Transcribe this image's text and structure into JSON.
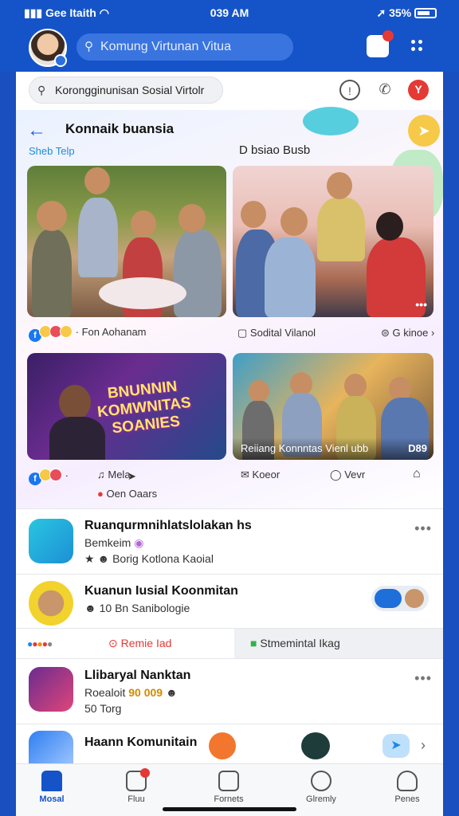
{
  "status_bar": {
    "carrier": "Gee Itaith",
    "time": "039 AM",
    "battery": "35%"
  },
  "app_bar": {
    "search_text": "Komung Virtunan Vitua"
  },
  "search_bar": {
    "text": "Korongginunisan Sosial Virtolr"
  },
  "hero": {
    "title": "Konnaik buansia",
    "sub_left": "Sheb Telp",
    "sub_right": "D bsiao Busb",
    "card1_meta": "· Fon Aohanam",
    "card2_meta_left": "Sodital  Vilanol",
    "card2_meta_right": "G kinoe",
    "card3_banner": "BNUNNIN KOMWNITAS SOANIES",
    "card3_meta_left": "Mela",
    "card3_meta_sub": "Oen Oaars",
    "card4_caption": "Reiiang Konnntas Vienl ubb",
    "card4_caption_right": "D89",
    "card4_meta_left": "Koeor",
    "card4_meta_right": "Vevr"
  },
  "list": [
    {
      "title": "Ruanqurmnihlatslolakan hs",
      "line2": "Bemkeim",
      "line3": "Borig Kotlona Kaoial"
    },
    {
      "title": "Kuanun  Iusial Koonmitan",
      "line2": "10  Bn Sanibologie"
    },
    {
      "tab_left": "Remie Iad",
      "tab_right": "Stmemintal Ikag"
    },
    {
      "title": "Llibaryal Nanktan",
      "line2_label": "Roealoit",
      "line2_value": "90 009",
      "line3": "50  Torg"
    },
    {
      "title": "Haann   Komunitain"
    }
  ],
  "tabs": [
    {
      "label": "Mosal"
    },
    {
      "label": "Fluu"
    },
    {
      "label": "Fornets"
    },
    {
      "label": "Glremly"
    },
    {
      "label": "Penes"
    }
  ],
  "colors": {
    "brand": "#1553c9",
    "accent": "#e53935"
  }
}
